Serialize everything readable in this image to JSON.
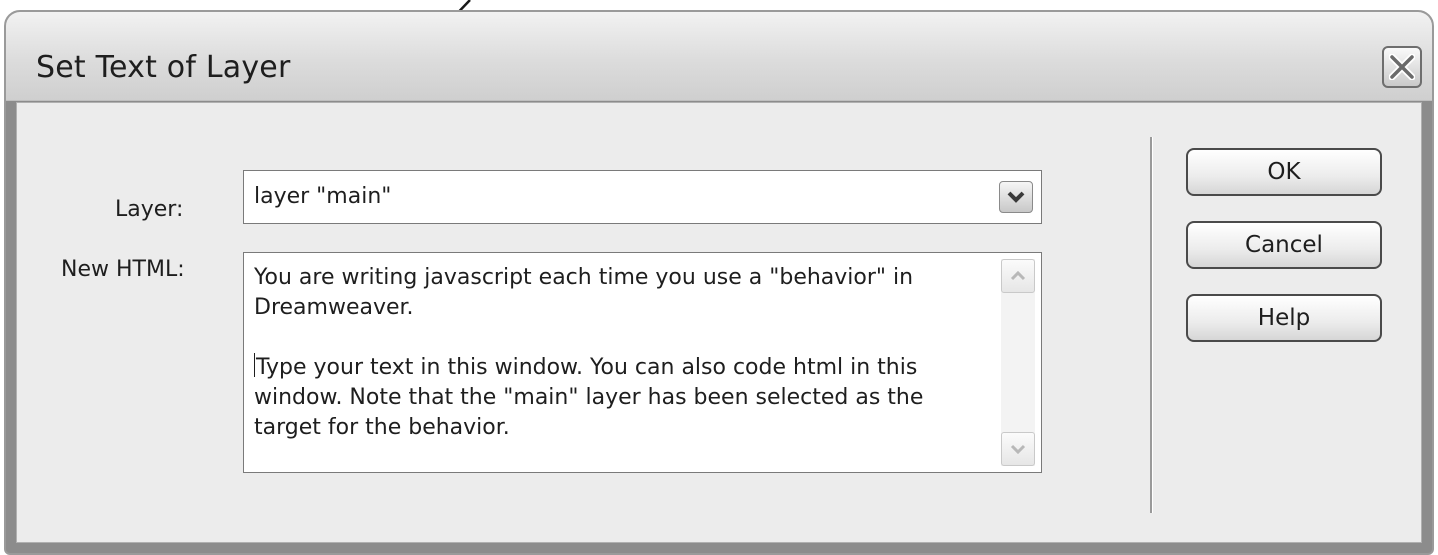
{
  "dialog": {
    "title": "Set Text of Layer",
    "close_icon": "close-icon"
  },
  "form": {
    "layer_label": "Layer:",
    "layer_value": "layer \"main\"",
    "html_label": "New HTML:",
    "html_paragraph_1": "You are writing javascript each time you use a \"behavior\" in Dreamweaver.",
    "html_paragraph_2": "Type your text in this window. You can also code html in this window. Note that the \"main\" layer has been selected as the target for the behavior."
  },
  "buttons": {
    "ok": "OK",
    "cancel": "Cancel",
    "help": "Help"
  },
  "icons": {
    "dropdown": "chevron-down-icon",
    "scroll_up": "scroll-up-icon",
    "scroll_down": "scroll-down-icon",
    "annotation": "arrow-icon"
  },
  "colors": {
    "window_frame": "#8c8c8c",
    "client_bg": "#ececec",
    "titlebar": "#dcdcdc"
  }
}
